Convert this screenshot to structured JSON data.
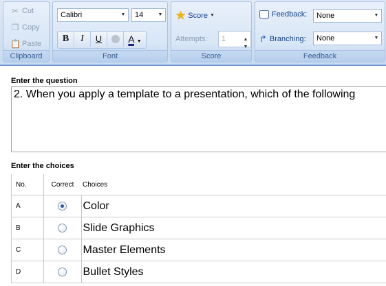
{
  "ribbon": {
    "clipboard": {
      "label": "Clipboard",
      "cut_label": "Cut",
      "copy_label": "Copy",
      "paste_label": "Paste"
    },
    "font": {
      "label": "Font",
      "family_value": "Calibri",
      "size_value": "14",
      "bold_label": "B",
      "italic_label": "I",
      "underline_label": "U",
      "color_label": "A"
    },
    "score": {
      "label": "Score",
      "score_button_label": "Score",
      "attempts_label": "Attempts:",
      "attempts_value": "1"
    },
    "feedback": {
      "label": "Feedback",
      "feedback_label": "Feedback:",
      "feedback_value": "None",
      "branching_label": "Branching:",
      "branching_value": "None"
    }
  },
  "question": {
    "section_title": "Enter the question",
    "text": "2. When you apply a template to a presentation, which of the following"
  },
  "choices": {
    "section_title": "Enter the choices",
    "headers": {
      "no": "No.",
      "correct": "Correct",
      "choices": "Choices"
    },
    "rows": [
      {
        "no": "A",
        "correct": true,
        "text": "Color"
      },
      {
        "no": "B",
        "correct": false,
        "text": "Slide Graphics"
      },
      {
        "no": "C",
        "correct": false,
        "text": "Master Elements"
      },
      {
        "no": "D",
        "correct": false,
        "text": "Bullet Styles"
      }
    ]
  },
  "colors": {
    "ribbon_text": "#15428b",
    "ribbon_bg": "#d8e6f6",
    "radio_selected": "#2b56a3",
    "star": "#f5b400"
  }
}
